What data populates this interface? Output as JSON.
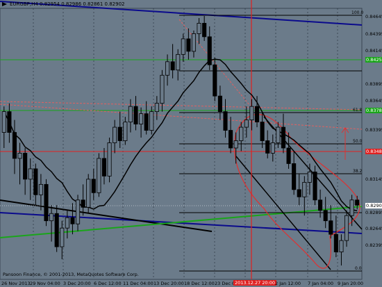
{
  "header": {
    "symbol_line": "EURGBP,H4 0.82954 0.82986 0.82861 0.82902"
  },
  "footer": {
    "copyright": "Pansoon Finance, © 2001-2013, MetaQuotes Software Corp."
  },
  "price_axis": {
    "ticks": [
      "0.84645",
      "0.84395",
      "0.84145",
      "0.83895",
      "0.83645",
      "0.83395",
      "0.83145",
      "0.82895",
      "0.82645",
      "0.82395"
    ],
    "tags": [
      {
        "label": "0.84257",
        "color": "#1aa51a",
        "text_color": "#ffffff"
      },
      {
        "label": "0.83788",
        "color": "#1aa51a",
        "text_color": "#ffffff"
      },
      {
        "label": "0.83483",
        "color": "#e02020",
        "text_color": "#ffffff"
      },
      {
        "label": "0.82902",
        "color": "#ffffff",
        "text_color": "#000000"
      }
    ]
  },
  "time_axis": {
    "ticks": [
      "26 Nov 2013",
      "29 Nov 04:00",
      "3 Dec 20:00",
      "6 Dec 12:00",
      "11 Dec 04:00",
      "13 Dec 20:00",
      "18 Dec 12:00",
      "23 Dec 0",
      "2 Jan 12:00",
      "7 Jan 04:00",
      "9 Jan 20:00"
    ],
    "cursor_label": "2013.12.27 20:00"
  },
  "fibonacci_levels": [
    "100.0",
    "61.8",
    "50.0",
    "38.2",
    "0.0"
  ],
  "colors": {
    "background": "#6b7b8a",
    "candle": "#000000",
    "moving_average": "#000000",
    "support": "#1aa51a",
    "resistance": "#e02020",
    "trendline": "#0a0a8c",
    "channel_outline": "#e03030"
  },
  "chart_data": {
    "type": "candlestick",
    "symbol": "EURGBP",
    "timeframe": "H4",
    "last_bar": {
      "open": 0.82954,
      "high": 0.82986,
      "low": 0.82861,
      "close": 0.82902
    },
    "ylim": [
      0.822,
      0.8478
    ],
    "horizontal_levels": [
      {
        "price": 0.84257,
        "color": "green"
      },
      {
        "price": 0.83788,
        "color": "green"
      },
      {
        "price": 0.83483,
        "color": "red"
      }
    ],
    "ohlc": [
      [
        0.836,
        0.8385,
        0.8345,
        0.838
      ],
      [
        0.838,
        0.8388,
        0.835,
        0.836
      ],
      [
        0.836,
        0.8372,
        0.832,
        0.8335
      ],
      [
        0.8335,
        0.835,
        0.831,
        0.834
      ],
      [
        0.834,
        0.8345,
        0.83,
        0.8315
      ],
      [
        0.8315,
        0.8335,
        0.8295,
        0.8325
      ],
      [
        0.8325,
        0.833,
        0.829,
        0.83
      ],
      [
        0.83,
        0.832,
        0.8285,
        0.831
      ],
      [
        0.831,
        0.8315,
        0.827,
        0.8275
      ],
      [
        0.8275,
        0.829,
        0.8255,
        0.8282
      ],
      [
        0.8282,
        0.829,
        0.8245,
        0.825
      ],
      [
        0.825,
        0.8275,
        0.8238,
        0.8268
      ],
      [
        0.8268,
        0.8285,
        0.8258,
        0.8278
      ],
      [
        0.8278,
        0.8292,
        0.8262,
        0.8272
      ],
      [
        0.8272,
        0.83,
        0.8265,
        0.8295
      ],
      [
        0.8295,
        0.831,
        0.828,
        0.8288
      ],
      [
        0.8288,
        0.832,
        0.8282,
        0.8315
      ],
      [
        0.8315,
        0.8325,
        0.8295,
        0.8302
      ],
      [
        0.8302,
        0.834,
        0.8298,
        0.8335
      ],
      [
        0.8335,
        0.8345,
        0.831,
        0.8318
      ],
      [
        0.8318,
        0.8355,
        0.8312,
        0.835
      ],
      [
        0.835,
        0.8372,
        0.834,
        0.8365
      ],
      [
        0.8365,
        0.838,
        0.8345,
        0.8352
      ],
      [
        0.8352,
        0.8375,
        0.8348,
        0.837
      ],
      [
        0.837,
        0.8392,
        0.836,
        0.8385
      ],
      [
        0.8385,
        0.8395,
        0.8362,
        0.8368
      ],
      [
        0.8368,
        0.8384,
        0.8355,
        0.8378
      ],
      [
        0.8378,
        0.839,
        0.8358,
        0.8362
      ],
      [
        0.8362,
        0.8385,
        0.8358,
        0.838
      ],
      [
        0.838,
        0.8395,
        0.8372,
        0.8388
      ],
      [
        0.8388,
        0.842,
        0.838,
        0.8415
      ],
      [
        0.8415,
        0.8435,
        0.8405,
        0.8428
      ],
      [
        0.8428,
        0.8445,
        0.8412,
        0.842
      ],
      [
        0.842,
        0.844,
        0.841,
        0.8435
      ],
      [
        0.8435,
        0.8455,
        0.8428,
        0.845
      ],
      [
        0.845,
        0.846,
        0.843,
        0.8438
      ],
      [
        0.8438,
        0.8458,
        0.8432,
        0.8455
      ],
      [
        0.8455,
        0.847,
        0.8445,
        0.8465
      ],
      [
        0.8465,
        0.8472,
        0.8448,
        0.8452
      ],
      [
        0.8452,
        0.8462,
        0.842,
        0.8425
      ],
      [
        0.8425,
        0.8432,
        0.839,
        0.8395
      ],
      [
        0.8395,
        0.8405,
        0.8372,
        0.838
      ],
      [
        0.838,
        0.8392,
        0.8355,
        0.8362
      ],
      [
        0.8362,
        0.8375,
        0.834,
        0.8345
      ],
      [
        0.8345,
        0.836,
        0.833,
        0.8352
      ],
      [
        0.8352,
        0.837,
        0.8342,
        0.8365
      ],
      [
        0.8365,
        0.8385,
        0.8355,
        0.8372
      ],
      [
        0.8372,
        0.8392,
        0.8362,
        0.8385
      ],
      [
        0.8385,
        0.8395,
        0.8365,
        0.837
      ],
      [
        0.837,
        0.838,
        0.8345,
        0.8352
      ],
      [
        0.8352,
        0.8362,
        0.8335,
        0.834
      ],
      [
        0.834,
        0.8358,
        0.8332,
        0.835
      ],
      [
        0.835,
        0.837,
        0.8345,
        0.8365
      ],
      [
        0.8365,
        0.8378,
        0.834,
        0.8345
      ],
      [
        0.8345,
        0.836,
        0.8325,
        0.833
      ],
      [
        0.833,
        0.8342,
        0.83,
        0.8305
      ],
      [
        0.8305,
        0.832,
        0.829,
        0.8298
      ],
      [
        0.8298,
        0.8318,
        0.828,
        0.8312
      ],
      [
        0.8312,
        0.833,
        0.83,
        0.8322
      ],
      [
        0.8322,
        0.8328,
        0.829,
        0.8295
      ],
      [
        0.8295,
        0.8305,
        0.8278,
        0.8285
      ],
      [
        0.8285,
        0.8298,
        0.8268,
        0.8275
      ],
      [
        0.8275,
        0.829,
        0.8258,
        0.8262
      ],
      [
        0.8262,
        0.828,
        0.824,
        0.8245
      ],
      [
        0.8245,
        0.8262,
        0.8232,
        0.8256
      ],
      [
        0.8256,
        0.8285,
        0.825,
        0.828
      ],
      [
        0.828,
        0.83,
        0.827,
        0.8295
      ],
      [
        0.8295,
        0.8299,
        0.8286,
        0.829
      ]
    ]
  }
}
